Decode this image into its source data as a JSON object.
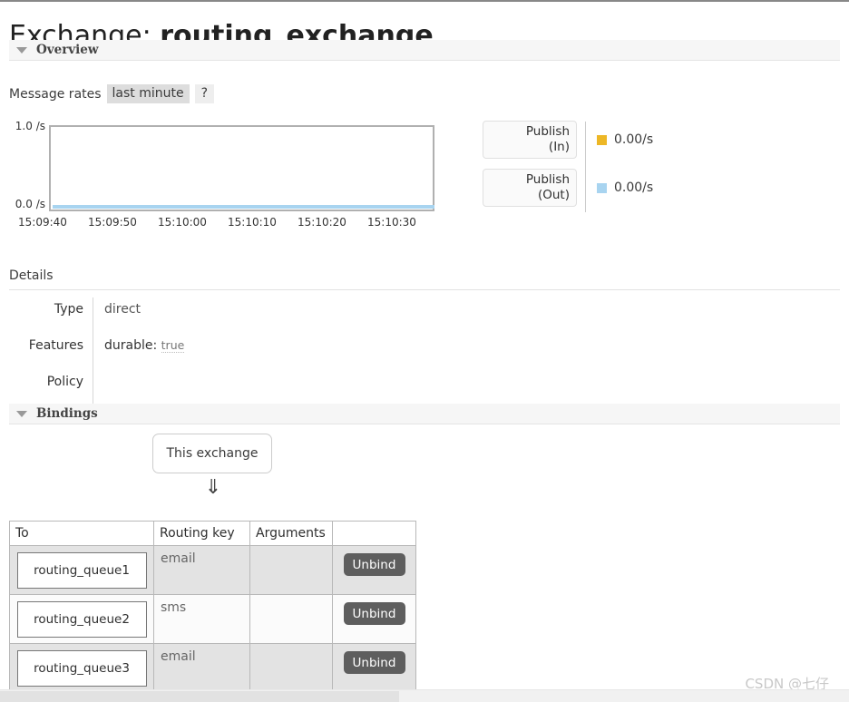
{
  "page": {
    "title_prefix": "Exchange: ",
    "exchange_name": "routing_exchange"
  },
  "overview": {
    "section_label": "Overview",
    "toggle_icon": "triangle-down-icon",
    "rates": {
      "label": "Message rates",
      "period": "last minute",
      "help": "?"
    }
  },
  "chart_data": {
    "type": "line",
    "title": "Message rates",
    "xlabel": "",
    "ylabel": "",
    "ylim": [
      0.0,
      1.0
    ],
    "y_ticks": [
      "1.0 /s",
      "0.0 /s"
    ],
    "grid": false,
    "legend_position": "right",
    "x": [
      "15:09:40",
      "15:09:50",
      "15:10:00",
      "15:10:10",
      "15:10:20",
      "15:10:30"
    ],
    "series": [
      {
        "name": "Publish (In)",
        "label_line1": "Publish",
        "label_line2": "(In)",
        "color": "#edb726",
        "current_rate": "0.00/s",
        "values": [
          0.0,
          0.0,
          0.0,
          0.0,
          0.0,
          0.0
        ]
      },
      {
        "name": "Publish (Out)",
        "label_line1": "Publish",
        "label_line2": "(Out)",
        "color": "#a8d4f0",
        "current_rate": "0.00/s",
        "values": [
          0.0,
          0.0,
          0.0,
          0.0,
          0.0,
          0.0
        ]
      }
    ]
  },
  "details": {
    "title": "Details",
    "rows": [
      {
        "key": "Type",
        "value": "direct"
      },
      {
        "key": "Features",
        "feature_name": "durable:",
        "feature_value": "true"
      },
      {
        "key": "Policy",
        "value": ""
      }
    ]
  },
  "bindings": {
    "section_label": "Bindings",
    "toggle_icon": "triangle-down-icon",
    "source_box": "This exchange",
    "arrow_icon": "double-down-arrow-icon",
    "columns": [
      "To",
      "Routing key",
      "Arguments",
      ""
    ],
    "rows": [
      {
        "to": "routing_queue1",
        "routing_key": "email",
        "arguments": "",
        "action": "Unbind"
      },
      {
        "to": "routing_queue2",
        "routing_key": "sms",
        "arguments": "",
        "action": "Unbind"
      },
      {
        "to": "routing_queue3",
        "routing_key": "email",
        "arguments": "",
        "action": "Unbind"
      }
    ]
  },
  "watermark": "CSDN @七仔"
}
